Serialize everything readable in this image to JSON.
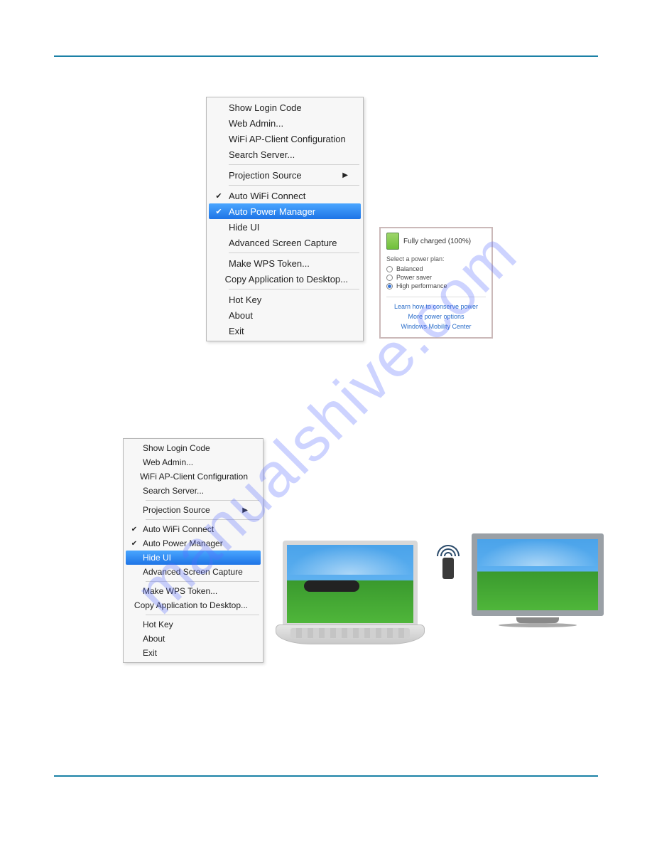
{
  "watermark": "manualshive.com",
  "menu1": {
    "items": [
      {
        "label": "Show Login Code"
      },
      {
        "label": "Web Admin..."
      },
      {
        "label": "WiFi AP-Client Configuration"
      },
      {
        "label": "Search Server..."
      }
    ],
    "source": {
      "label": "Projection Source"
    },
    "group2": [
      {
        "label": "Auto WiFi Connect",
        "checked": true
      },
      {
        "label": "Auto Power Manager",
        "checked": true,
        "highlight": true
      },
      {
        "label": "Hide UI"
      },
      {
        "label": "Advanced Screen Capture"
      }
    ],
    "group3": [
      {
        "label": "Make WPS Token..."
      },
      {
        "label": "Copy Application to Desktop..."
      }
    ],
    "group4": [
      {
        "label": "Hot Key"
      },
      {
        "label": "About"
      },
      {
        "label": "Exit"
      }
    ]
  },
  "menu2": {
    "items": [
      {
        "label": "Show Login Code"
      },
      {
        "label": "Web Admin..."
      },
      {
        "label": "WiFi AP-Client Configuration"
      },
      {
        "label": "Search Server..."
      }
    ],
    "source": {
      "label": "Projection Source"
    },
    "group2": [
      {
        "label": "Auto WiFi Connect",
        "checked": true
      },
      {
        "label": "Auto Power Manager",
        "checked": true
      },
      {
        "label": "Hide UI",
        "highlight": true
      },
      {
        "label": "Advanced Screen Capture"
      }
    ],
    "group3": [
      {
        "label": "Make WPS Token..."
      },
      {
        "label": "Copy Application to Desktop..."
      }
    ],
    "group4": [
      {
        "label": "Hot Key"
      },
      {
        "label": "About"
      },
      {
        "label": "Exit"
      }
    ]
  },
  "power": {
    "status": "Fully charged (100%)",
    "plan_title": "Select a power plan:",
    "plans": [
      {
        "label": "Balanced",
        "selected": false
      },
      {
        "label": "Power saver",
        "selected": false
      },
      {
        "label": "High performance",
        "selected": true
      }
    ],
    "links": [
      "Learn how to conserve power",
      "More power options",
      "Windows Mobility Center"
    ]
  }
}
